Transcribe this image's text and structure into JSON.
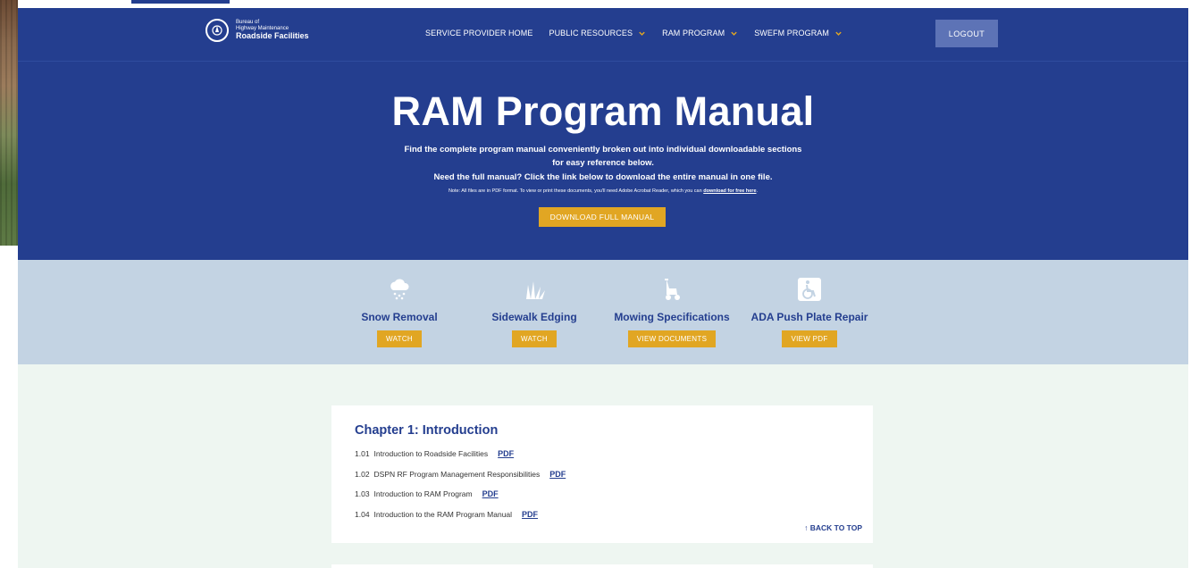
{
  "logo": {
    "small_line1": "Bureau of",
    "small_line2": "Highway Maintenance",
    "name": "Roadside Facilities"
  },
  "nav": {
    "items": [
      {
        "label": "SERVICE PROVIDER HOME",
        "dropdown": false
      },
      {
        "label": "PUBLIC RESOURCES",
        "dropdown": true
      },
      {
        "label": "RAM PROGRAM",
        "dropdown": true
      },
      {
        "label": "SWEFM PROGRAM",
        "dropdown": true
      }
    ],
    "logout_label": "LOGOUT"
  },
  "hero": {
    "title": "RAM Program Manual",
    "line1": "Find the complete program manual conveniently broken out into individual downloadable sections",
    "line2": "for easy reference below.",
    "line3": "Need the full manual? Click the link below to download the entire manual in one file.",
    "note": "Note: All files are in PDF format. To view or print these documents, you'll need Adobe Acrobat Reader, which you can",
    "note_link": "download for free here",
    "note_end": ".",
    "download_label": "DOWNLOAD FULL MANUAL"
  },
  "features": [
    {
      "title": "Snow Removal",
      "button": "WATCH",
      "icon": "snow-cloud-icon"
    },
    {
      "title": "Sidewalk Edging",
      "button": "WATCH",
      "icon": "grass-icon"
    },
    {
      "title": "Mowing Specifications",
      "button": "VIEW DOCUMENTS",
      "icon": "mower-icon"
    },
    {
      "title": "ADA Push Plate Repair",
      "button": "VIEW PDF",
      "icon": "wheelchair-icon"
    }
  ],
  "chapter": {
    "title": "Chapter 1: Introduction",
    "items": [
      {
        "number": "1.01",
        "label": "Introduction to Roadside Facilities",
        "link": "PDF"
      },
      {
        "number": "1.02",
        "label": "DSPN RF Program Management Responsibilities",
        "link": "PDF"
      },
      {
        "number": "1.03",
        "label": "Introduction to RAM Program",
        "link": "PDF"
      },
      {
        "number": "1.04",
        "label": "Introduction to the RAM Program Manual",
        "link": "PDF"
      }
    ],
    "back_to_top": "↑ BACK TO TOP"
  },
  "colors": {
    "brand_blue": "#243e8f",
    "accent_gold": "#e1a623",
    "features_bg": "#c3d3e3",
    "content_bg": "#eef6f1"
  }
}
